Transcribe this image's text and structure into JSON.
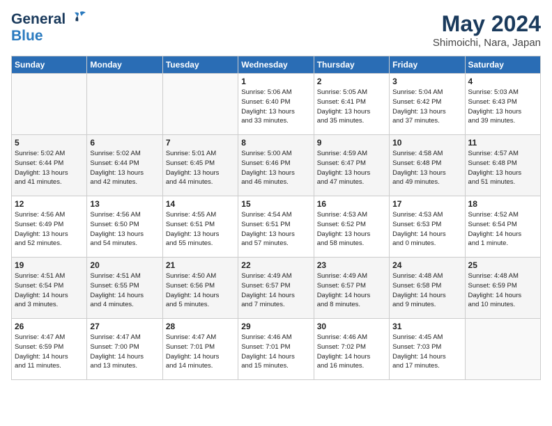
{
  "header": {
    "logo_general": "General",
    "logo_blue": "Blue",
    "month": "May 2024",
    "location": "Shimoichi, Nara, Japan"
  },
  "days_of_week": [
    "Sunday",
    "Monday",
    "Tuesday",
    "Wednesday",
    "Thursday",
    "Friday",
    "Saturday"
  ],
  "weeks": [
    [
      {
        "day": "",
        "info": ""
      },
      {
        "day": "",
        "info": ""
      },
      {
        "day": "",
        "info": ""
      },
      {
        "day": "1",
        "info": "Sunrise: 5:06 AM\nSunset: 6:40 PM\nDaylight: 13 hours\nand 33 minutes."
      },
      {
        "day": "2",
        "info": "Sunrise: 5:05 AM\nSunset: 6:41 PM\nDaylight: 13 hours\nand 35 minutes."
      },
      {
        "day": "3",
        "info": "Sunrise: 5:04 AM\nSunset: 6:42 PM\nDaylight: 13 hours\nand 37 minutes."
      },
      {
        "day": "4",
        "info": "Sunrise: 5:03 AM\nSunset: 6:43 PM\nDaylight: 13 hours\nand 39 minutes."
      }
    ],
    [
      {
        "day": "5",
        "info": "Sunrise: 5:02 AM\nSunset: 6:44 PM\nDaylight: 13 hours\nand 41 minutes."
      },
      {
        "day": "6",
        "info": "Sunrise: 5:02 AM\nSunset: 6:44 PM\nDaylight: 13 hours\nand 42 minutes."
      },
      {
        "day": "7",
        "info": "Sunrise: 5:01 AM\nSunset: 6:45 PM\nDaylight: 13 hours\nand 44 minutes."
      },
      {
        "day": "8",
        "info": "Sunrise: 5:00 AM\nSunset: 6:46 PM\nDaylight: 13 hours\nand 46 minutes."
      },
      {
        "day": "9",
        "info": "Sunrise: 4:59 AM\nSunset: 6:47 PM\nDaylight: 13 hours\nand 47 minutes."
      },
      {
        "day": "10",
        "info": "Sunrise: 4:58 AM\nSunset: 6:48 PM\nDaylight: 13 hours\nand 49 minutes."
      },
      {
        "day": "11",
        "info": "Sunrise: 4:57 AM\nSunset: 6:48 PM\nDaylight: 13 hours\nand 51 minutes."
      }
    ],
    [
      {
        "day": "12",
        "info": "Sunrise: 4:56 AM\nSunset: 6:49 PM\nDaylight: 13 hours\nand 52 minutes."
      },
      {
        "day": "13",
        "info": "Sunrise: 4:56 AM\nSunset: 6:50 PM\nDaylight: 13 hours\nand 54 minutes."
      },
      {
        "day": "14",
        "info": "Sunrise: 4:55 AM\nSunset: 6:51 PM\nDaylight: 13 hours\nand 55 minutes."
      },
      {
        "day": "15",
        "info": "Sunrise: 4:54 AM\nSunset: 6:51 PM\nDaylight: 13 hours\nand 57 minutes."
      },
      {
        "day": "16",
        "info": "Sunrise: 4:53 AM\nSunset: 6:52 PM\nDaylight: 13 hours\nand 58 minutes."
      },
      {
        "day": "17",
        "info": "Sunrise: 4:53 AM\nSunset: 6:53 PM\nDaylight: 14 hours\nand 0 minutes."
      },
      {
        "day": "18",
        "info": "Sunrise: 4:52 AM\nSunset: 6:54 PM\nDaylight: 14 hours\nand 1 minute."
      }
    ],
    [
      {
        "day": "19",
        "info": "Sunrise: 4:51 AM\nSunset: 6:54 PM\nDaylight: 14 hours\nand 3 minutes."
      },
      {
        "day": "20",
        "info": "Sunrise: 4:51 AM\nSunset: 6:55 PM\nDaylight: 14 hours\nand 4 minutes."
      },
      {
        "day": "21",
        "info": "Sunrise: 4:50 AM\nSunset: 6:56 PM\nDaylight: 14 hours\nand 5 minutes."
      },
      {
        "day": "22",
        "info": "Sunrise: 4:49 AM\nSunset: 6:57 PM\nDaylight: 14 hours\nand 7 minutes."
      },
      {
        "day": "23",
        "info": "Sunrise: 4:49 AM\nSunset: 6:57 PM\nDaylight: 14 hours\nand 8 minutes."
      },
      {
        "day": "24",
        "info": "Sunrise: 4:48 AM\nSunset: 6:58 PM\nDaylight: 14 hours\nand 9 minutes."
      },
      {
        "day": "25",
        "info": "Sunrise: 4:48 AM\nSunset: 6:59 PM\nDaylight: 14 hours\nand 10 minutes."
      }
    ],
    [
      {
        "day": "26",
        "info": "Sunrise: 4:47 AM\nSunset: 6:59 PM\nDaylight: 14 hours\nand 11 minutes."
      },
      {
        "day": "27",
        "info": "Sunrise: 4:47 AM\nSunset: 7:00 PM\nDaylight: 14 hours\nand 13 minutes."
      },
      {
        "day": "28",
        "info": "Sunrise: 4:47 AM\nSunset: 7:01 PM\nDaylight: 14 hours\nand 14 minutes."
      },
      {
        "day": "29",
        "info": "Sunrise: 4:46 AM\nSunset: 7:01 PM\nDaylight: 14 hours\nand 15 minutes."
      },
      {
        "day": "30",
        "info": "Sunrise: 4:46 AM\nSunset: 7:02 PM\nDaylight: 14 hours\nand 16 minutes."
      },
      {
        "day": "31",
        "info": "Sunrise: 4:45 AM\nSunset: 7:03 PM\nDaylight: 14 hours\nand 17 minutes."
      },
      {
        "day": "",
        "info": ""
      }
    ]
  ]
}
